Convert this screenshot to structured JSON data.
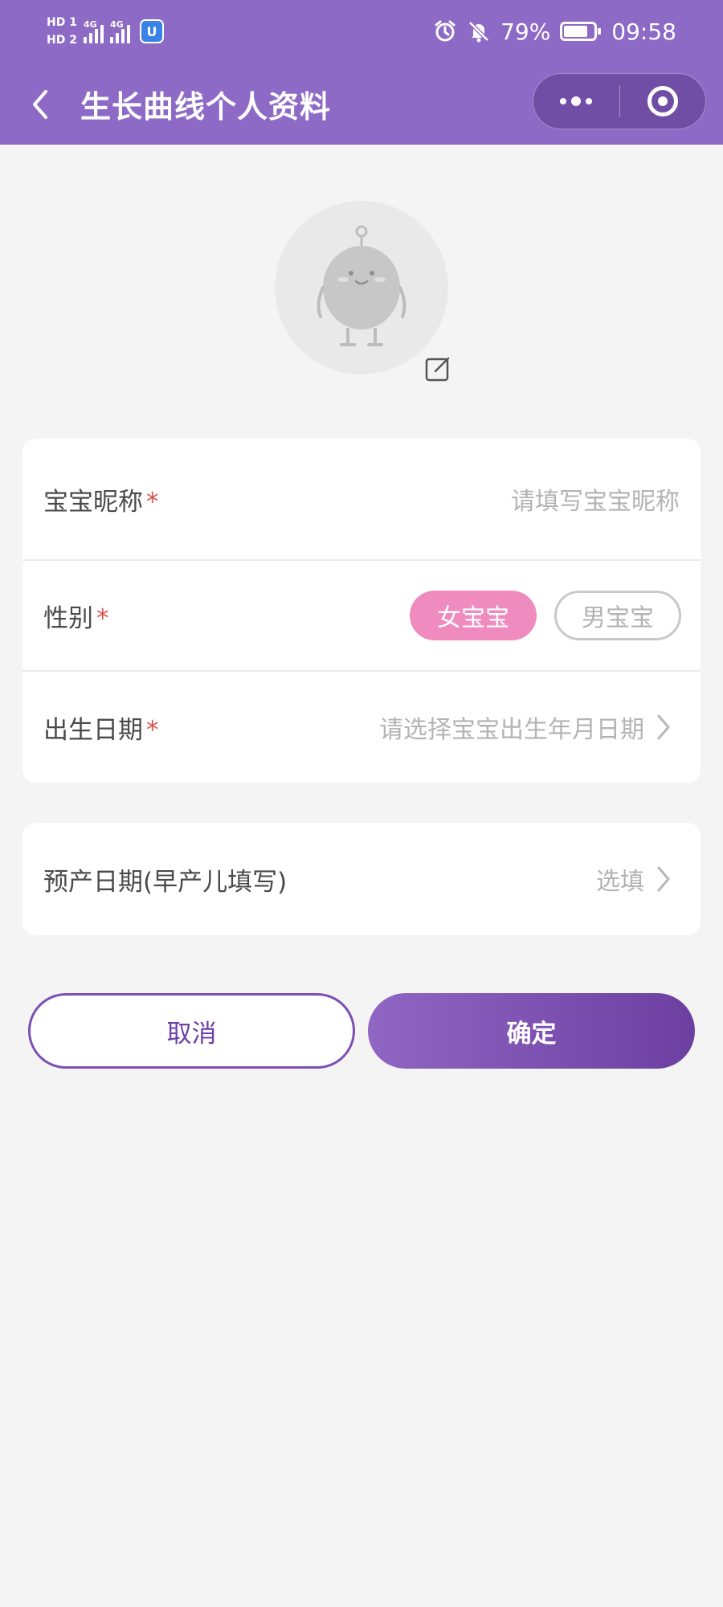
{
  "status_bar": {
    "sim1": "HD 1",
    "sim2": "HD 2",
    "net1": "4G",
    "net2": "4G",
    "app_badge": "U",
    "battery_percent": "79%",
    "battery_level": 0.79,
    "time": "09:58",
    "icons": [
      "alarm-icon",
      "mute-bell-icon",
      "battery-icon"
    ]
  },
  "nav": {
    "title": "生长曲线个人资料",
    "back_icon": "chevron-left-icon",
    "more_icon": "more-dots-icon",
    "close_icon": "target-circle-icon"
  },
  "avatar": {
    "edit_icon": "edit-square-icon"
  },
  "form": {
    "nickname": {
      "label": "宝宝昵称",
      "required_mark": "*",
      "placeholder": "请填写宝宝昵称"
    },
    "gender": {
      "label": "性别",
      "required_mark": "*",
      "options": [
        "女宝宝",
        "男宝宝"
      ],
      "selected": "女宝宝"
    },
    "birthdate": {
      "label": "出生日期",
      "required_mark": "*",
      "placeholder": "请选择宝宝出生年月日期"
    },
    "due_date": {
      "label": "预产日期(早产儿填写)",
      "placeholder": "选填"
    }
  },
  "buttons": {
    "cancel": "取消",
    "confirm": "确定"
  },
  "colors": {
    "header": "#8d6ac6",
    "accent_purple": "#7c4fb4",
    "female_pill": "#ef8bbf",
    "required": "#d9534f",
    "background": "#f4f4f5"
  }
}
